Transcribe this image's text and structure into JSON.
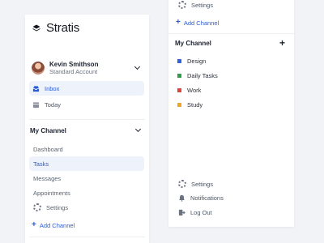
{
  "brand": {
    "name": "Stratis"
  },
  "user": {
    "name": "Kevin Smithson",
    "role": "Standard Account"
  },
  "nav": {
    "inbox": "Inbox",
    "today": "Today"
  },
  "left_channel": {
    "title": "My Channel",
    "items": [
      "Dashboard",
      "Tasks",
      "Messages",
      "Appointments"
    ],
    "settings": "Settings",
    "add_channel": "Add Channel"
  },
  "right_panel": {
    "settings_top": "Settings",
    "add_channel": "Add Channel",
    "channel_title": "My Channel",
    "channels": [
      {
        "label": "Design",
        "color": "#2f62e0"
      },
      {
        "label": "Daily Tasks",
        "color": "#2e9d4a"
      },
      {
        "label": "Work",
        "color": "#e0433a"
      },
      {
        "label": "Study",
        "color": "#f0a524"
      }
    ],
    "footer": {
      "settings": "Settings",
      "notifications": "Notifications",
      "logout": "Log Out"
    }
  },
  "colors": {
    "accent": "#2a5bd7",
    "active_bg": "#eef2fb",
    "background": "#f2f3f6"
  }
}
